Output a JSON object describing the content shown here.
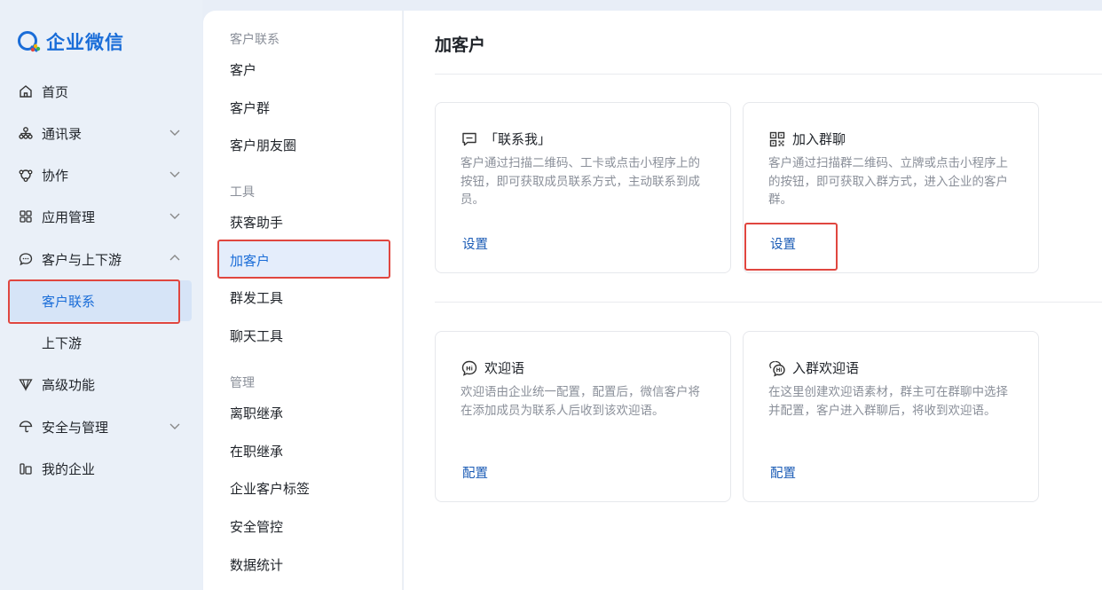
{
  "app": {
    "logo_text": "企业微信"
  },
  "sidebar": {
    "items": [
      {
        "label": "首页",
        "icon": "home-icon",
        "has_chevron": false
      },
      {
        "label": "通讯录",
        "icon": "org-chart-icon",
        "has_chevron": true,
        "expanded": false
      },
      {
        "label": "协作",
        "icon": "collab-icon",
        "has_chevron": true,
        "expanded": false
      },
      {
        "label": "应用管理",
        "icon": "apps-grid-icon",
        "has_chevron": true,
        "expanded": false
      },
      {
        "label": "客户与上下游",
        "icon": "chat-bubble-icon",
        "has_chevron": true,
        "expanded": true
      },
      {
        "label": "客户联系",
        "sub": true,
        "active": true
      },
      {
        "label": "上下游",
        "sub": true
      },
      {
        "label": "高级功能",
        "icon": "diamond-icon",
        "has_chevron": false
      },
      {
        "label": "安全与管理",
        "icon": "umbrella-icon",
        "has_chevron": true,
        "expanded": false
      },
      {
        "label": "我的企业",
        "icon": "building-icon",
        "has_chevron": false
      }
    ]
  },
  "subnav": {
    "group1": "客户联系",
    "items1": [
      "客户",
      "客户群",
      "客户朋友圈"
    ],
    "group2": "工具",
    "items2": [
      "获客助手",
      "加客户",
      "群发工具",
      "聊天工具"
    ],
    "active": "加客户",
    "group3": "管理",
    "items3": [
      "离职继承",
      "在职继承",
      "企业客户标签",
      "安全管控",
      "数据统计"
    ]
  },
  "main": {
    "title": "加客户",
    "cards": [
      {
        "title": "「联系我」",
        "icon": "chat-bubble-icon",
        "desc": "客户通过扫描二维码、工卡或点击小程序上的按钮，即可获取成员联系方式，主动联系到成员。",
        "action": "设置"
      },
      {
        "title": "加入群聊",
        "icon": "qr-code-icon",
        "desc": "客户通过扫描群二维码、立牌或点击小程序上的按钮，即可获取入群方式，进入企业的客户群。",
        "action": "设置"
      },
      {
        "title": "欢迎语",
        "icon": "hi-bubble-icon",
        "desc": "欢迎语由企业统一配置，配置后，微信客户将在添加成员为联系人后收到该欢迎语。",
        "action": "配置"
      },
      {
        "title": "入群欢迎语",
        "icon": "group-hi-bubble-icon",
        "desc": "在这里创建欢迎语素材，群主可在群聊中选择并配置，客户进入群聊后，将收到欢迎语。",
        "action": "配置"
      }
    ]
  },
  "colors": {
    "accent": "#1a6dd8",
    "link": "#1a5bb5",
    "highlight_box": "#e0463f"
  }
}
